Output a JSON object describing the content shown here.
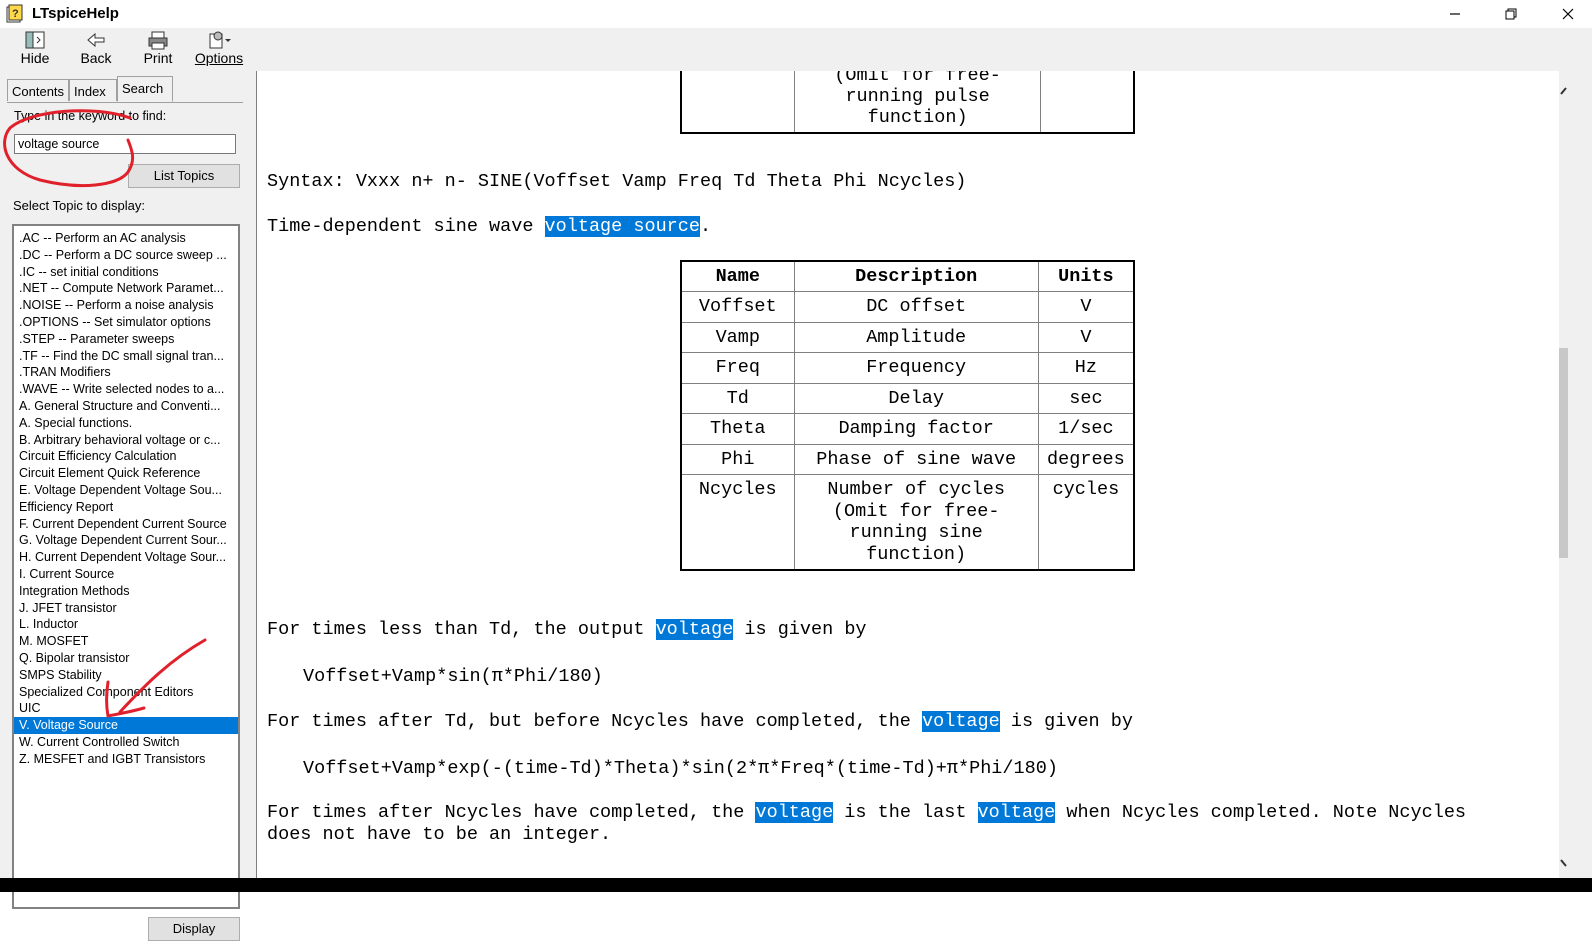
{
  "window": {
    "title": "LTspiceHelp",
    "accent": "#0078d7"
  },
  "toolbar": {
    "hide_label": "Hide",
    "back_label": "Back",
    "print_label": "Print",
    "options_label": "Options"
  },
  "nav": {
    "tabs": [
      {
        "label": "Contents"
      },
      {
        "label": "Index"
      },
      {
        "label": "Search"
      }
    ],
    "keyword_label": "Type in the keyword to find:",
    "keyword_value": "voltage source",
    "list_topics_label": "List Topics",
    "select_topic_label": "Select Topic to display:",
    "topics": [
      ".AC -- Perform an AC analysis",
      ".DC -- Perform a DC source sweep ...",
      ".IC  -- set initial conditions",
      ".NET  -- Compute Network Paramet...",
      ".NOISE  -- Perform a noise analysis",
      ".OPTIONS -- Set simulator options",
      ".STEP -- Parameter sweeps",
      ".TF  -- Find the DC small signal tran...",
      ".TRAN Modifiers",
      ".WAVE -- Write selected nodes to a...",
      "A.  General Structure and Conventi...",
      "A.  Special functions.",
      "B.  Arbitrary behavioral voltage or c...",
      "Circuit Efficiency Calculation",
      "Circuit Element Quick Reference",
      "E. Voltage Dependent Voltage Sou...",
      "Efficiency Report",
      "F. Current Dependent Current Source",
      "G. Voltage Dependent Current Sour...",
      "H. Current Dependent Voltage Sour...",
      "I. Current Source",
      "Integration Methods",
      "J. JFET transistor",
      "L. Inductor",
      "M. MOSFET",
      "Q. Bipolar transistor",
      "SMPS Stability",
      "Specialized Component Editors",
      "UIC",
      "V. Voltage Source",
      "W. Current Controlled Switch",
      "Z. MESFET and IGBT Transistors"
    ],
    "selected_index": 29,
    "display_label": "Display"
  },
  "doc": {
    "prev_table_tail": [
      "(Omit for free-",
      "running pulse",
      "function)"
    ],
    "syntax": "Syntax: Vxxx n+ n- SINE(Voffset Vamp Freq Td Theta Phi Ncycles)",
    "desc_prefix": "Time-dependent sine wave ",
    "desc_highlight": "voltage source",
    "desc_suffix": ".",
    "table": {
      "headers": [
        "Name",
        "Description",
        "Units"
      ],
      "rows": [
        [
          "Voffset",
          "DC offset",
          "V"
        ],
        [
          "Vamp",
          "Amplitude",
          "V"
        ],
        [
          "Freq",
          "Frequency",
          "Hz"
        ],
        [
          "Td",
          "Delay",
          "sec"
        ],
        [
          "Theta",
          "Damping factor",
          "1/sec"
        ],
        [
          "Phi",
          "Phase of sine wave",
          "degrees"
        ],
        [
          "Ncycles",
          "Number of cycles\n(Omit for free-\nrunning sine\nfunction)",
          "cycles"
        ]
      ]
    },
    "p1_a": "For times less than Td, the output ",
    "p1_hl": "voltage",
    "p1_b": " is given by",
    "formula1": "Voffset+Vamp*sin(π*Phi/180)",
    "p2_a": "For times after Td, but before Ncycles have completed, the ",
    "p2_hl": "voltage",
    "p2_b": " is given by",
    "formula2": "Voffset+Vamp*exp(-(time-Td)*Theta)*sin(2*π*Freq*(time-Td)+π*Phi/180)",
    "p3_a": "For times after Ncycles have completed, the ",
    "p3_hl1": "voltage",
    "p3_b": " is the last ",
    "p3_hl2": "voltage",
    "p3_c": " when Ncycles completed. Note Ncycles",
    "p3_line2": "does not have to be an integer."
  }
}
